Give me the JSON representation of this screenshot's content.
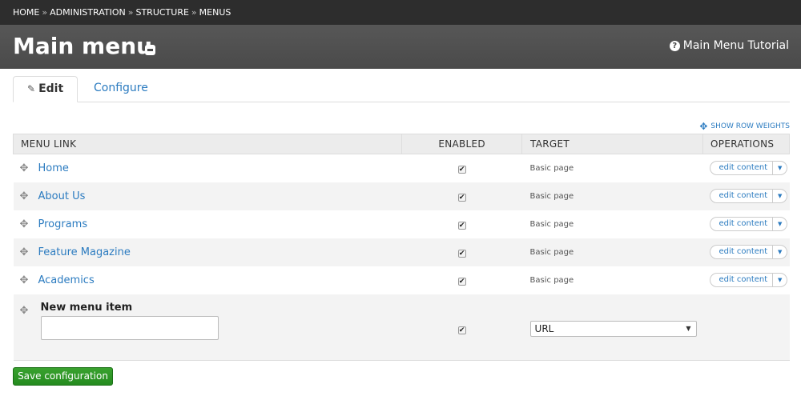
{
  "breadcrumb": {
    "items": [
      "HOME",
      "ADMINISTRATION",
      "STRUCTURE",
      "MENUS"
    ],
    "separator": "»"
  },
  "header": {
    "title": "Main menu",
    "tutorial_label": "Main Menu Tutorial"
  },
  "tabs": {
    "edit_label": "Edit",
    "configure_label": "Configure"
  },
  "show_row_weights": "SHOW ROW WEIGHTS",
  "table": {
    "columns": [
      "MENU LINK",
      "ENABLED",
      "TARGET",
      "OPERATIONS"
    ],
    "rows": [
      {
        "link": "Home",
        "enabled": true,
        "target": "Basic page",
        "operation": "edit content"
      },
      {
        "link": "About Us",
        "enabled": true,
        "target": "Basic page",
        "operation": "edit content"
      },
      {
        "link": "Programs",
        "enabled": true,
        "target": "Basic page",
        "operation": "edit content"
      },
      {
        "link": "Feature Magazine",
        "enabled": true,
        "target": "Basic page",
        "operation": "edit content"
      },
      {
        "link": "Academics",
        "enabled": true,
        "target": "Basic page",
        "operation": "edit content"
      }
    ],
    "new_item": {
      "label": "New menu item",
      "value": "",
      "enabled": true,
      "target_selected": "URL"
    }
  },
  "save_label": "Save configuration",
  "colors": {
    "link": "#2b7bc0",
    "save": "#2e9a26",
    "header_bg": "#4a4a4a",
    "crumb_bg": "#2d2d2d"
  }
}
